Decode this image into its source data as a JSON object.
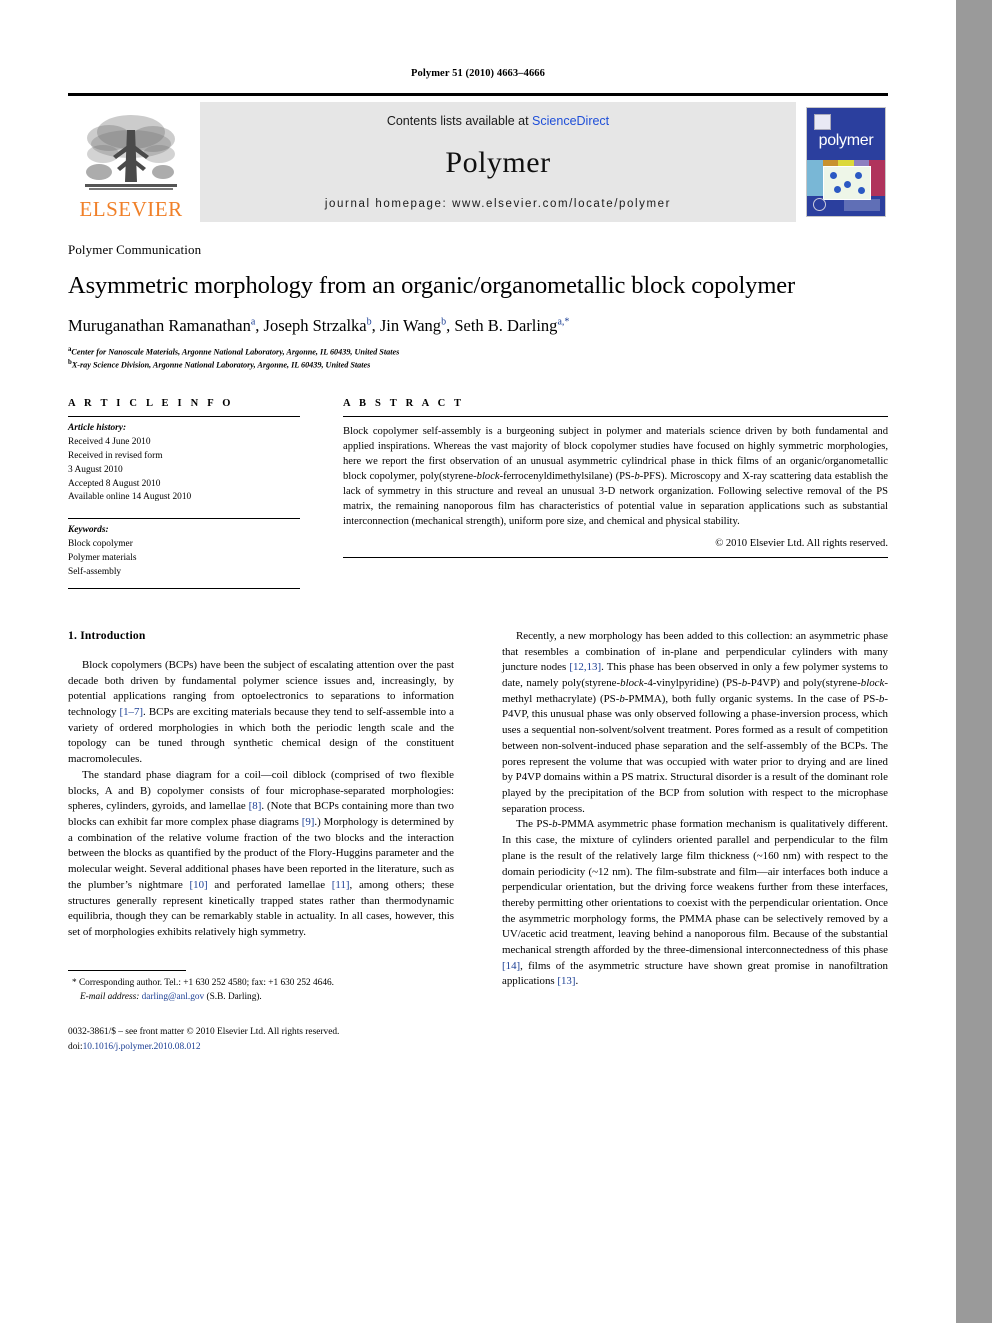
{
  "window": {
    "scrollbar_color": "#9a9a9a",
    "page_background": "#ffffff"
  },
  "running_head": "Polymer 51 (2010) 4663–4666",
  "masthead": {
    "publisher_name": "ELSEVIER",
    "publisher_logo_name": "elsevier-tree-logo",
    "contents_prefix": "Contents lists available at ",
    "sciencedirect": "ScienceDirect",
    "journal_title": "Polymer",
    "homepage_line": "journal homepage: www.elsevier.com/locate/polymer",
    "cover": {
      "title": "polymer",
      "background": "#2b3f9e"
    }
  },
  "article": {
    "section_label": "Polymer Communication",
    "title": "Asymmetric morphology from an organic/organometallic block copolymer",
    "authors_html": "Muruganathan Ramanathan<sup>a</sup>, Joseph Strzalka<sup>b</sup>, Jin Wang<sup>b</sup>, Seth B. Darling<sup>a,</sup><sup>*</sup>",
    "affiliations": [
      "Center for Nanoscale Materials, Argonne National Laboratory, Argonne, IL 60439, United States",
      "X-ray Science Division, Argonne National Laboratory, Argonne, IL 60439, United States"
    ],
    "affiliation_markers": [
      "a",
      "b"
    ]
  },
  "article_info": {
    "heading": "A R T I C L E   I N F O",
    "history_label": "Article history:",
    "history": [
      "Received 4 June 2010",
      "Received in revised form",
      "3 August 2010",
      "Accepted 8 August 2010",
      "Available online 14 August 2010"
    ],
    "keywords_label": "Keywords:",
    "keywords": [
      "Block copolymer",
      "Polymer materials",
      "Self-assembly"
    ]
  },
  "abstract": {
    "heading": "A B S T R A C T",
    "text_html": "Block copolymer self-assembly is a burgeoning subject in polymer and materials science driven by both fundamental and applied inspirations. Whereas the vast majority of block copolymer studies have focused on highly symmetric morphologies, here we report the first observation of an unusual asymmetric cylindrical phase in thick films of an organic/organometallic block copolymer, poly(styrene-<i>block</i>-ferrocenyldimethylsilane) (PS-<i>b</i>-PFS). Microscopy and X-ray scattering data establish the lack of symmetry in this structure and reveal an unusual 3-D network organization. Following selective removal of the PS matrix, the remaining nanoporous film has characteristics of potential value in separation applications such as substantial interconnection (mechanical strength), uniform pore size, and chemical and physical stability.",
    "copyright": "© 2010 Elsevier Ltd. All rights reserved."
  },
  "body": {
    "left_column": {
      "heading": "1. Introduction",
      "paragraphs_html": [
        "Block copolymers (BCPs) have been the subject of escalating attention over the past decade both driven by fundamental polymer science issues and, increasingly, by potential applications ranging from optoelectronics to separations to information technology <span class=\"ref\">[1&#8211;7]</span>. BCPs are exciting materials because they tend to self-assemble into a variety of ordered morphologies in which both the periodic length scale and the topology can be tuned through synthetic chemical design of the constituent macromolecules.",
        "The standard phase diagram for a coil&#8212;coil diblock (comprised of two flexible blocks, A and B) copolymer consists of four microphase-separated morphologies: spheres, cylinders, gyroids, and lamellae <span class=\"ref\">[8]</span>. (Note that BCPs containing more than two blocks can exhibit far more complex phase diagrams <span class=\"ref\">[9]</span>.) Morphology is determined by a combination of the relative volume fraction of the two blocks and the interaction between the blocks as quantified by the product of the Flory-Huggins parameter and the molecular weight. Several additional phases have been reported in the literature, such as the plumber&#8217;s nightmare <span class=\"ref\">[10]</span> and perforated lamellae <span class=\"ref\">[11]</span>, among others; these structures generally represent kinetically trapped states rather than thermodynamic equilibria, though they can be remarkably stable in actuality. In all cases, however, this set of morphologies exhibits relatively high symmetry."
      ]
    },
    "right_column": {
      "paragraphs_html": [
        "Recently, a new morphology has been added to this collection: an asymmetric phase that resembles a combination of in-plane and perpendicular cylinders with many juncture nodes <span class=\"ref\">[12,13]</span>. This phase has been observed in only a few polymer systems to date, namely poly(styrene-<i>block</i>-4-vinylpyridine) (PS-<i>b</i>-P4VP) and poly(styrene-<i>block</i>-methyl methacrylate) (PS-<i>b</i>-PMMA), both fully organic systems. In the case of PS-<i>b</i>-P4VP, this unusual phase was only observed following a phase-inversion process, which uses a sequential non-solvent/solvent treatment. Pores formed as a result of competition between non-solvent-induced phase separation and the self-assembly of the BCPs. The pores represent the volume that was occupied with water prior to drying and are lined by P4VP domains within a PS matrix. Structural disorder is a result of the dominant role played by the precipitation of the BCP from solution with respect to the microphase separation process.",
        "The PS-<i>b</i>-PMMA asymmetric phase formation mechanism is qualitatively different. In this case, the mixture of cylinders oriented parallel and perpendicular to the film plane is the result of the relatively large film thickness (~160 nm) with respect to the domain periodicity (~12 nm). The film-substrate and film&#8212;air interfaces both induce a perpendicular orientation, but the driving force weakens further from these interfaces, thereby permitting other orientations to coexist with the perpendicular orientation. Once the asymmetric morphology forms, the PMMA phase can be selectively removed by a UV/acetic acid treatment, leaving behind a nanoporous film. Because of the substantial mechanical strength afforded by the three-dimensional interconnectedness of this phase <span class=\"ref\">[14]</span>, films of the asymmetric structure have shown great promise in nanofiltration applications <span class=\"ref\">[13]</span>."
      ]
    }
  },
  "footnote": {
    "corresponding_html": "* Corresponding author. Tel.: +1 630 252 4580; fax: +1 630 252 4646.",
    "email_label": "E-mail address:",
    "email": "darling@anl.gov",
    "email_owner": "(S.B. Darling)."
  },
  "imprint": {
    "line1": "0032-3861/$ – see front matter © 2010 Elsevier Ltd. All rights reserved.",
    "doi_label": "doi:",
    "doi": "10.1016/j.polymer.2010.08.012"
  }
}
